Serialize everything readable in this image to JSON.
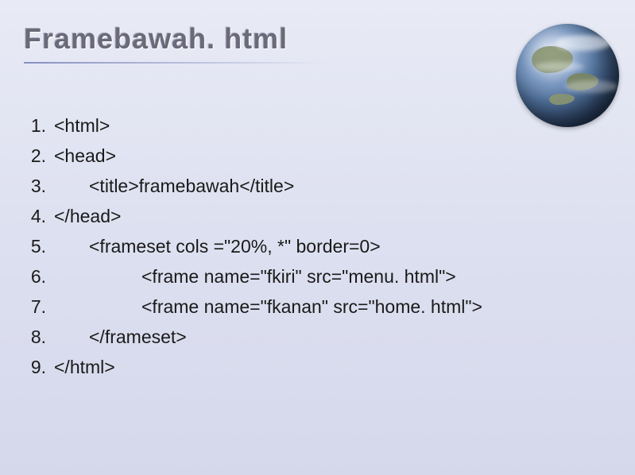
{
  "title": "Framebawah. html",
  "lines": [
    {
      "num": "1.",
      "text": "<html>",
      "indent": 0
    },
    {
      "num": "2.",
      "text": "<head>",
      "indent": 0
    },
    {
      "num": "3.",
      "text": "<title>framebawah</title>",
      "indent": 1
    },
    {
      "num": "4.",
      "text": "</head>",
      "indent": 0
    },
    {
      "num": "5.",
      "text": "<frameset cols =\"20%, *\" border=0>",
      "indent": 1
    },
    {
      "num": "6.",
      "text": "<frame name=\"fkiri\" src=\"menu. html\">",
      "indent": 2
    },
    {
      "num": "7.",
      "text": "<frame name=\"fkanan\" src=\"home. html\">",
      "indent": 2
    },
    {
      "num": "8.",
      "text": "</frameset>",
      "indent": 1
    },
    {
      "num": "9.",
      "text": "</html>",
      "indent": 0
    }
  ]
}
